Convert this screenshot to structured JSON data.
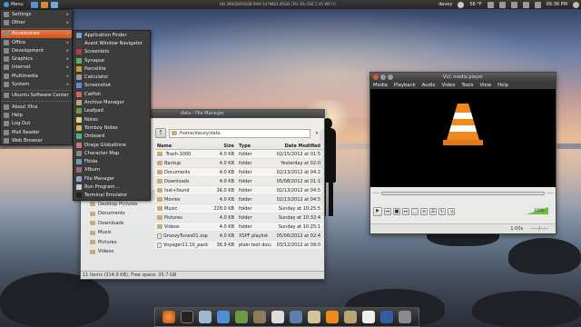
{
  "top_panel": {
    "menu_label": "Menu",
    "system_monitor": "HD  390GB/916GB   RAM  347MB/1.95GB   CPU  3%   CHZ  2.45   WIFI  0",
    "user": "davey",
    "weather": "56 °F",
    "time": "06:36 PM"
  },
  "main_menu": {
    "items": [
      {
        "label": "Settings",
        "submenu": true
      },
      {
        "label": "Other",
        "submenu": true
      },
      {
        "label": "Accessories",
        "submenu": true,
        "selected": true
      },
      {
        "label": "Office",
        "submenu": true
      },
      {
        "label": "Development",
        "submenu": true
      },
      {
        "label": "Graphics",
        "submenu": true
      },
      {
        "label": "Internet",
        "submenu": true
      },
      {
        "label": "Multimedia",
        "submenu": true
      },
      {
        "label": "System",
        "submenu": true
      },
      {
        "label": "Ubuntu Software Center",
        "submenu": false
      },
      {
        "label": "About Xfce",
        "submenu": false
      },
      {
        "label": "Help",
        "submenu": false
      },
      {
        "label": "Log Out",
        "submenu": false
      },
      {
        "label": "Mail Reader",
        "submenu": false
      },
      {
        "label": "Web Browser",
        "submenu": false
      }
    ]
  },
  "accessories_menu": {
    "items": [
      "Application Finder",
      "Avant Window Navigator",
      "Screenlets",
      "Synapse",
      "Parcellite",
      "Calculator",
      "Screenshot",
      "Catfish",
      "Archive Manager",
      "Leafpad",
      "Notes",
      "Tomboy Notes",
      "Onboard",
      "Orage Globaltime",
      "Character Map",
      "Fbida",
      "Xfburn",
      "File Manager",
      "Run Program...",
      "Terminal Emulator"
    ]
  },
  "file_manager": {
    "title": "data - File Manager",
    "location": "/home/davey/data",
    "columns": [
      "Name",
      "Size",
      "Type",
      "Date Modified"
    ],
    "sidebar": [
      "data",
      "Desktop Pictures",
      "Documents",
      "Downloads",
      "Music",
      "Pictures",
      "Videos"
    ],
    "rows": [
      {
        "name": ".Trash-1000",
        "size": "4.0 KB",
        "type": "folder",
        "date": "02/15/2012 at 01:5"
      },
      {
        "name": "Backup",
        "size": "4.0 KB",
        "type": "folder",
        "date": "Yesterday at 02:0"
      },
      {
        "name": "Documents",
        "size": "4.0 KB",
        "type": "folder",
        "date": "02/13/2012 at 04:2"
      },
      {
        "name": "Downloads",
        "size": "4.0 KB",
        "type": "folder",
        "date": "05/08/2012 at 01:1"
      },
      {
        "name": "lost+found",
        "size": "16.0 KB",
        "type": "folder",
        "date": "02/13/2012 at 04:5"
      },
      {
        "name": "Movies",
        "size": "4.0 KB",
        "type": "folder",
        "date": "02/13/2012 at 04:5"
      },
      {
        "name": "Music",
        "size": "228.0 KB",
        "type": "folder",
        "date": "Sunday at 10:25:5"
      },
      {
        "name": "Pictures",
        "size": "4.0 KB",
        "type": "folder",
        "date": "Sunday at 10:32:4"
      },
      {
        "name": "Videos",
        "size": "4.0 KB",
        "type": "folder",
        "date": "Sunday at 10:25:1"
      },
      {
        "name": "GroovyTunes01.xspf",
        "size": "4.0 KB",
        "type": "XSPF playlist",
        "date": "05/06/2012 at 02:4"
      },
      {
        "name": "Voyager11.10_pack",
        "size": "36.9 KB",
        "type": "plain text document",
        "date": "03/12/2012 at 09:0"
      }
    ],
    "status": "11 items (314.9 KB), Free space: 35.7 GB"
  },
  "vlc": {
    "title": "VLC media player",
    "menu": [
      "Media",
      "Playback",
      "Audio",
      "Video",
      "Tools",
      "View",
      "Help"
    ],
    "time_left": "--:--",
    "time_right": "--:--",
    "speed": "1.00x",
    "status_time": "--:--/--:--",
    "volume_percent": "100%"
  },
  "colors": {
    "menu_highlight": "#e8622e",
    "vlc_cone": "#f08a1c"
  }
}
